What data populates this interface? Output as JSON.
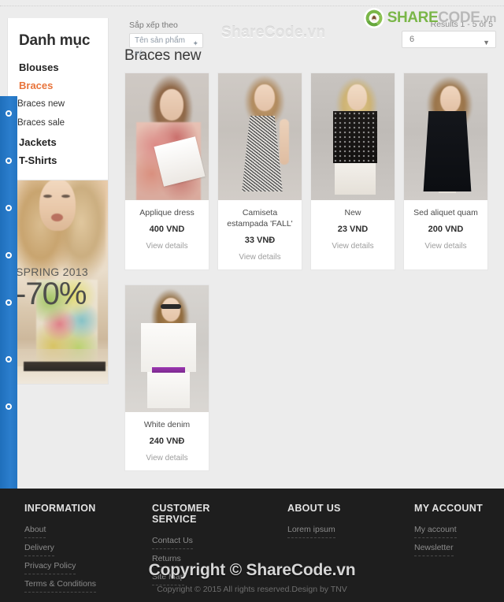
{
  "watermark": {
    "top": "ShareCode.vn",
    "footer_big": "Copyright © ShareCode.vn",
    "footer_small": "Copyright © 2015 All rights reserved.Design by TNV"
  },
  "logo": {
    "share": "SHARE",
    "code": "CODE",
    "vn": ".vn",
    "icon": "recycle-logo-icon"
  },
  "toolbar": {
    "sort_label": "Sắp xếp theo",
    "sort_value": "Tên sản phẩm +/-",
    "sort_caret": "✦",
    "results_text": "Results 1 - 5 of 5",
    "per_page_value": "6",
    "per_page_caret": "▼"
  },
  "sidebar": {
    "title": "Danh mục",
    "items": [
      {
        "label": "Blouses",
        "level": "top",
        "active": false
      },
      {
        "label": "Braces",
        "level": "top",
        "active": true
      },
      {
        "label": "Braces new",
        "level": "sub",
        "active": false
      },
      {
        "label": "Braces sale",
        "level": "sub",
        "active": false
      },
      {
        "label": "Jackets",
        "level": "top",
        "active": false
      },
      {
        "label": "T-Shirts",
        "level": "top",
        "active": false
      }
    ]
  },
  "promo": {
    "season": "SPRING 2013",
    "discount": "-70%"
  },
  "main": {
    "title": "Braces new",
    "products": [
      {
        "name": "Applique dress",
        "price": "400 VND",
        "view": "View details",
        "photo": "p1"
      },
      {
        "name": "Camiseta estampada 'FALL'",
        "price": "33 VNĐ",
        "view": "View details",
        "photo": "p2"
      },
      {
        "name": "New",
        "price": "23 VND",
        "view": "View details",
        "photo": "p3"
      },
      {
        "name": "Sed aliquet quam",
        "price": "200 VND",
        "view": "View details",
        "photo": "p4"
      },
      {
        "name": "White denim",
        "price": "240 VNĐ",
        "view": "View details",
        "photo": "p5"
      }
    ]
  },
  "footer": {
    "columns": [
      {
        "heading": "INFORMATION",
        "links": [
          "About",
          "Delivery",
          "Privacy Policy",
          "Terms & Conditions"
        ]
      },
      {
        "heading": "CUSTOMER SERVICE",
        "links": [
          "Contact Us",
          "Returns",
          "Site Map"
        ]
      },
      {
        "heading": "ABOUT US",
        "links": [
          "Lorem ipsum"
        ]
      },
      {
        "heading": "MY ACCOUNT",
        "links": [
          "My account",
          "Newsletter"
        ]
      }
    ]
  },
  "colors": {
    "accent_orange": "#e8743b",
    "rail_blue": "#2475c2",
    "logo_green": "#7ab648",
    "footer_bg": "#1e1e1e",
    "page_bg": "#ececec"
  }
}
